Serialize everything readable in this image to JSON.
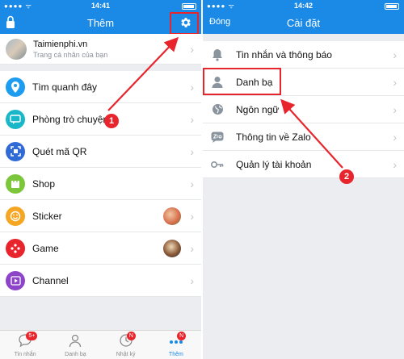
{
  "left": {
    "status": {
      "time": "14:41"
    },
    "header": {
      "title": "Thêm"
    },
    "profile": {
      "name": "Taimienphi.vn",
      "subtitle": "Trang cá nhân của bạn"
    },
    "menu": [
      {
        "label": "Tìm quanh đây",
        "icon": "location-pin-icon",
        "color": "#1e9cf0"
      },
      {
        "label": "Phòng trò chuyện",
        "icon": "chat-room-icon",
        "color": "#1ab7c9"
      },
      {
        "label": "Quét mã QR",
        "icon": "qr-scan-icon",
        "color": "#2f6ad6"
      },
      {
        "label": "Shop",
        "icon": "shop-bag-icon",
        "color": "#7cc63c"
      },
      {
        "label": "Sticker",
        "icon": "sticker-smile-icon",
        "color": "#f5a623"
      },
      {
        "label": "Game",
        "icon": "game-pad-icon",
        "color": "#e8242c"
      },
      {
        "label": "Channel",
        "icon": "channel-play-icon",
        "color": "#8e44c8"
      }
    ],
    "tabs": [
      {
        "label": "Tin nhắn",
        "badge": "5+"
      },
      {
        "label": "Danh bạ",
        "badge": ""
      },
      {
        "label": "Nhật ký",
        "badge": "N"
      },
      {
        "label": "Thêm",
        "badge": "N"
      }
    ]
  },
  "right": {
    "status": {
      "time": "14:42"
    },
    "header": {
      "title": "Cài đặt",
      "close": "Đóng"
    },
    "items": [
      {
        "label": "Tin nhắn và thông báo",
        "icon": "bell-icon"
      },
      {
        "label": "Danh bạ",
        "icon": "contact-person-icon"
      },
      {
        "label": "Ngôn ngữ",
        "icon": "globe-icon"
      },
      {
        "label": "Thông tin về Zalo",
        "icon": "zalo-info-icon"
      },
      {
        "label": "Quản lý tài khoản",
        "icon": "key-icon"
      }
    ]
  },
  "annotations": {
    "marker1": "1",
    "marker2": "2",
    "color": "#e8242c"
  }
}
